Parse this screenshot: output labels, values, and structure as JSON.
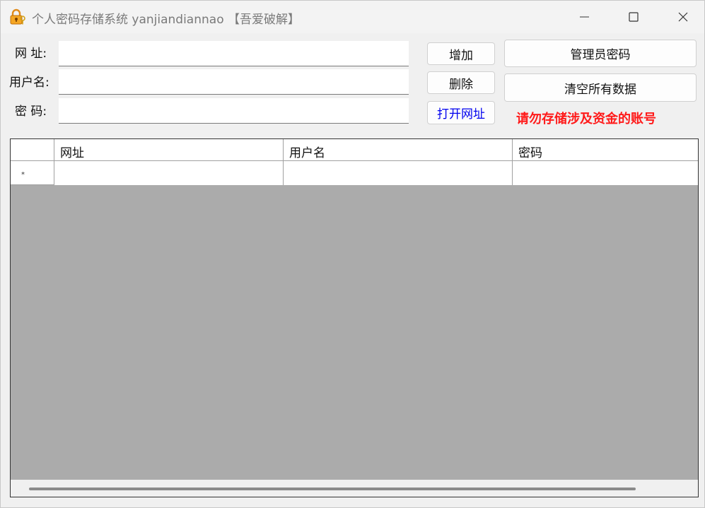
{
  "window": {
    "title": "个人密码存储系统 yanjiandiannao 【吾爱破解】",
    "icon": "lock-key-icon"
  },
  "form": {
    "url_label": "网 址:",
    "username_label": "用户名:",
    "password_label": "密 码:",
    "url_value": "",
    "username_value": "",
    "password_value": ""
  },
  "buttons": {
    "add": "增加",
    "delete": "删除",
    "open_url": "打开网址",
    "admin_password": "管理员密码",
    "clear_all": "清空所有数据"
  },
  "warning": "请勿存储涉及资金的账号",
  "grid": {
    "columns": [
      "",
      "网址",
      "用户名",
      "密码"
    ],
    "new_row_marker": "*"
  },
  "colors": {
    "warning": "#ff1a1a",
    "link_button": "#0000ee",
    "grid_background": "#ababab"
  }
}
